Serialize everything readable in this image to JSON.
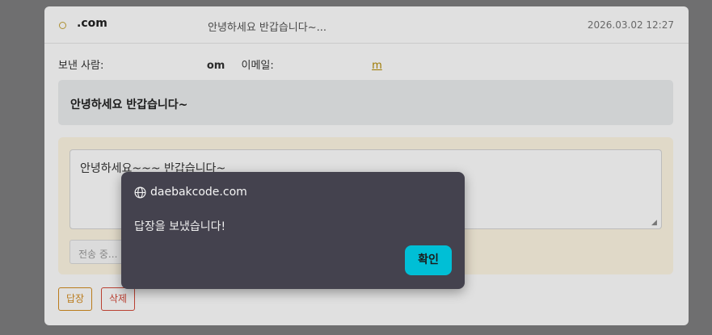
{
  "mail": {
    "sender_domain": ".com",
    "preview": "안녕하세요 반갑습니다~...",
    "date": "2026.03.02 12:27",
    "from_label": "보낸 사람:",
    "from_value": "om",
    "email_label": "이메일:",
    "email_value": "m",
    "subject": "안녕하세요 반갑습니다~"
  },
  "reply": {
    "text": "안녕하세요~~~ 반갑습니다~",
    "send_button": "전송 중..."
  },
  "actions": {
    "reply": "답장",
    "delete": "삭제"
  },
  "dialog": {
    "site": "daebakcode.com",
    "message": "답장을 보냈습니다!",
    "ok": "확인",
    "icon": "globe-icon"
  },
  "colors": {
    "ok_button": "#00bfd6",
    "dialog_bg": "#44424e",
    "reply_accent": "#d48c1f",
    "delete_accent": "#d44a3a"
  }
}
